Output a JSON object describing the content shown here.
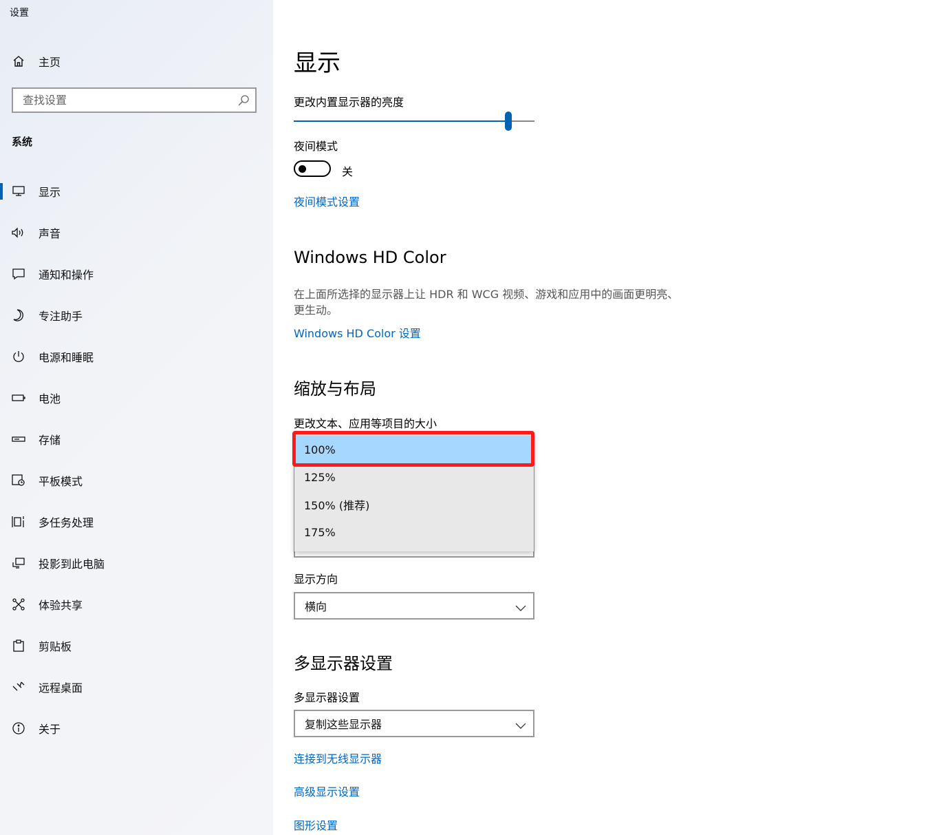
{
  "window": {
    "title": "设置"
  },
  "sidebar": {
    "home_label": "主页",
    "search_placeholder": "查找设置",
    "section_label": "系统",
    "items": [
      {
        "label": "显示",
        "icon": "monitor-icon",
        "active": true
      },
      {
        "label": "声音",
        "icon": "speaker-icon"
      },
      {
        "label": "通知和操作",
        "icon": "notification-icon"
      },
      {
        "label": "专注助手",
        "icon": "moon-icon"
      },
      {
        "label": "电源和睡眠",
        "icon": "power-icon"
      },
      {
        "label": "电池",
        "icon": "battery-icon"
      },
      {
        "label": "存储",
        "icon": "storage-icon"
      },
      {
        "label": "平板模式",
        "icon": "tablet-icon"
      },
      {
        "label": "多任务处理",
        "icon": "multitask-icon"
      },
      {
        "label": "投影到此电脑",
        "icon": "project-icon"
      },
      {
        "label": "体验共享",
        "icon": "share-icon"
      },
      {
        "label": "剪贴板",
        "icon": "clipboard-icon"
      },
      {
        "label": "远程桌面",
        "icon": "remote-icon"
      },
      {
        "label": "关于",
        "icon": "info-icon"
      }
    ]
  },
  "main": {
    "title": "显示",
    "brightness": {
      "label": "更改内置显示器的亮度",
      "value_fraction": 0.89
    },
    "night_mode": {
      "label": "夜间模式",
      "state": "关",
      "link": "夜间模式设置"
    },
    "hd_color": {
      "title": "Windows HD Color",
      "desc": "在上面所选择的显示器上让 HDR 和 WCG 视频、游戏和应用中的画面更明亮、更生动。",
      "link": "Windows HD Color 设置"
    },
    "scale_layout": {
      "title": "缩放与布局",
      "label": "更改文本、应用等项目的大小",
      "options": [
        "100%",
        "125%",
        "150% (推荐)",
        "175%"
      ],
      "selected_index": 0
    },
    "orientation": {
      "label": "显示方向",
      "value": "横向"
    },
    "multi_display": {
      "title": "多显示器设置",
      "label": "多显示器设置",
      "value": "复制这些显示器",
      "links": [
        "连接到无线显示器",
        "高级显示设置",
        "图形设置"
      ]
    }
  },
  "colors": {
    "accent": "#0063b1",
    "link": "#0067c0",
    "highlight": "#ff1a1a",
    "selected": "#a6d8ff"
  }
}
